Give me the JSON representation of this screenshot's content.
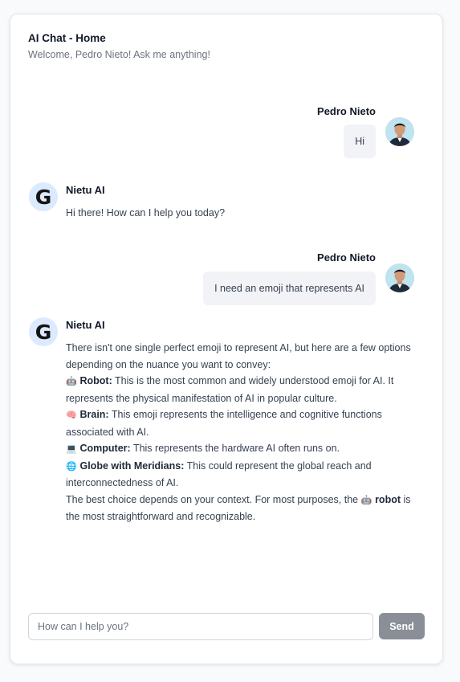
{
  "header": {
    "title": "AI Chat - Home",
    "subtitle": "Welcome, Pedro Nieto! Ask me anything!"
  },
  "messages": [
    {
      "role": "user",
      "name": "Pedro Nieto",
      "text": "Hi"
    },
    {
      "role": "ai",
      "name": "Nietu AI",
      "text": "Hi there! How can I help you today?"
    },
    {
      "role": "user",
      "name": "Pedro Nieto",
      "text": "I need an emoji that represents AI"
    },
    {
      "role": "ai",
      "name": "Nietu AI",
      "intro": "There isn't one single perfect emoji to represent AI, but here are a few options depending on the nuance you want to convey:",
      "options": [
        {
          "emoji": "🤖",
          "icon": "robot-emoji",
          "label": "Robot:",
          "text": "This is the most common and widely understood emoji for AI. It represents the physical manifestation of AI in popular culture."
        },
        {
          "emoji": "🧠",
          "icon": "brain-emoji",
          "label": "Brain:",
          "text": "This emoji represents the intelligence and cognitive functions associated with AI."
        },
        {
          "emoji": "💻",
          "icon": "computer-emoji",
          "label": "Computer:",
          "text": "This represents the hardware AI often runs on."
        },
        {
          "emoji": "🌐",
          "icon": "globe-emoji",
          "label": "Globe with Meridians:",
          "text": "This could represent the global reach and interconnectedness of AI."
        }
      ],
      "closing_before": "The best choice depends on your context. For most purposes, the",
      "closing_emoji": "🤖",
      "closing_bold": "robot",
      "closing_after": "is the most straightforward and recognizable."
    }
  ],
  "ai_avatar_letter": "G",
  "input": {
    "placeholder": "How can I help you?",
    "value": ""
  },
  "send_label": "Send",
  "colors": {
    "send_button": "#8a8f97",
    "user_bubble": "#f1f3f6",
    "ai_avatar_bg": "#dbeafe"
  }
}
